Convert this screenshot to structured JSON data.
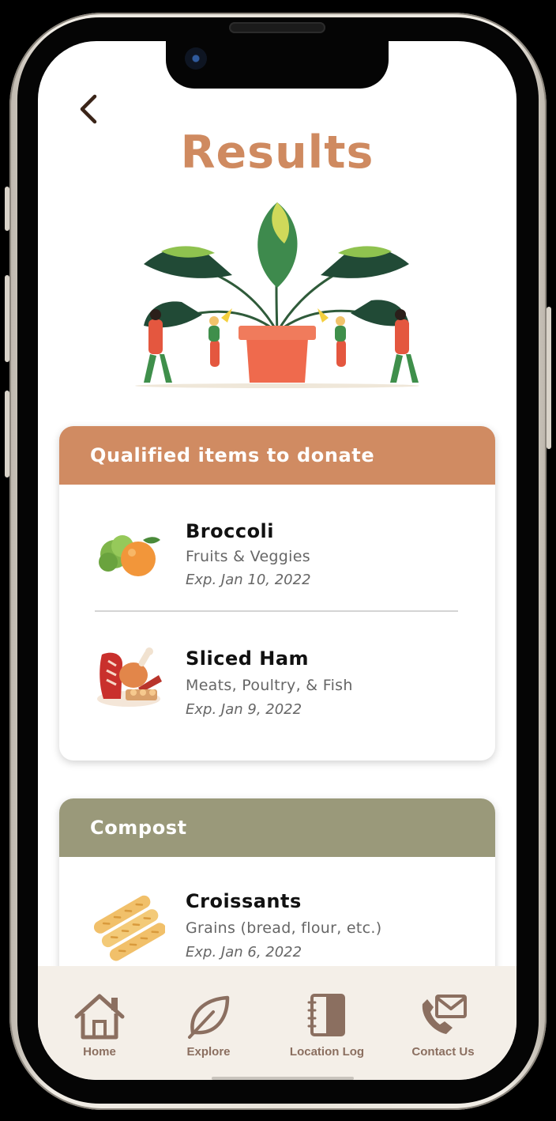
{
  "colors": {
    "title": "#cf8a60",
    "donate_header": "#d08b62",
    "compost_header": "#9a997a",
    "tabbar_bg": "#f4efe8",
    "tab_icon": "#8b6f60"
  },
  "header": {
    "back_icon": "chevron-left-icon",
    "title": "Results"
  },
  "hero": {
    "illustration": "potted-plant-with-people-illustration"
  },
  "sections": [
    {
      "title": "Qualified items to donate",
      "items": [
        {
          "name": "Broccoli",
          "category": "Fruits & Veggies",
          "expiry": "Exp. Jan 10, 2022",
          "icon": "fruits-veggies-icon"
        },
        {
          "name": "Sliced Ham",
          "category": "Meats, Poultry, & Fish",
          "expiry": "Exp. Jan 9, 2022",
          "icon": "meats-poultry-icon"
        }
      ]
    },
    {
      "title": "Compost",
      "items": [
        {
          "name": "Croissants",
          "category": "Grains (bread, flour, etc.)",
          "expiry": "Exp. Jan 6, 2022",
          "icon": "bread-loaves-icon"
        }
      ]
    }
  ],
  "tabbar": {
    "tabs": [
      {
        "label": "Home",
        "icon": "home-icon"
      },
      {
        "label": "Explore",
        "icon": "leaf-icon"
      },
      {
        "label": "Location Log",
        "icon": "notebook-icon"
      },
      {
        "label": "Contact Us",
        "icon": "phone-mail-icon"
      }
    ]
  }
}
